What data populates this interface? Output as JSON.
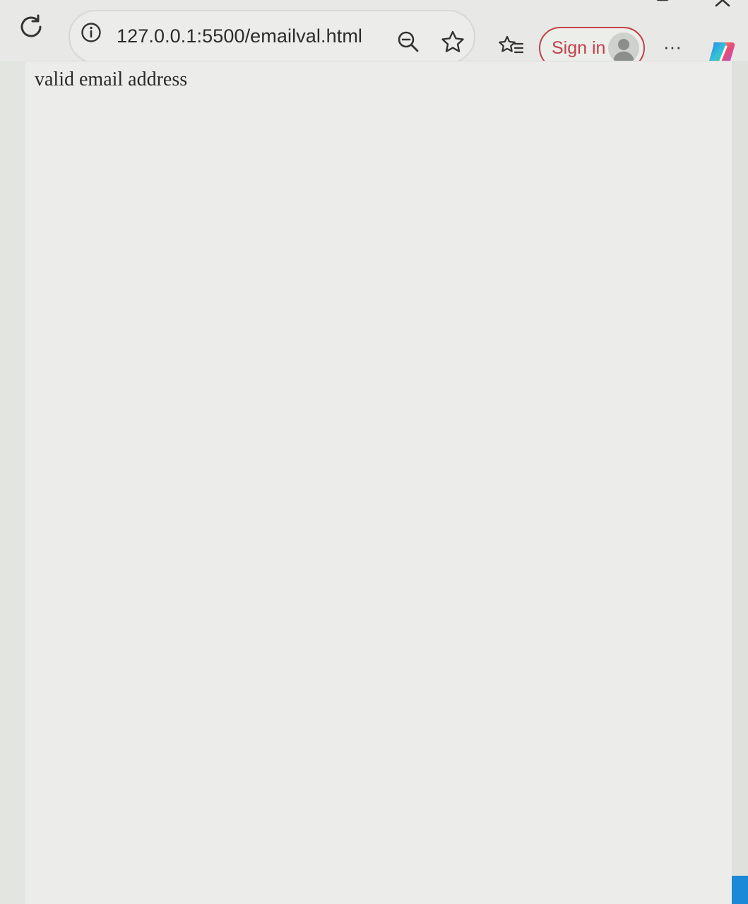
{
  "browser": {
    "address_bar": {
      "url": "127.0.0.1:5500/emailval.html"
    },
    "toolbar": {
      "sign_in_label": "Sign in",
      "more_label": "···"
    },
    "accent_color": "#c2404a",
    "icons": {
      "refresh": "refresh-icon",
      "info": "info-icon",
      "zoom_out": "zoom-out-icon",
      "favorite": "star-icon",
      "favorites_list": "favorites-icon",
      "profile": "profile-icon",
      "copilot": "copilot-icon"
    }
  },
  "page": {
    "text": "valid email address"
  }
}
